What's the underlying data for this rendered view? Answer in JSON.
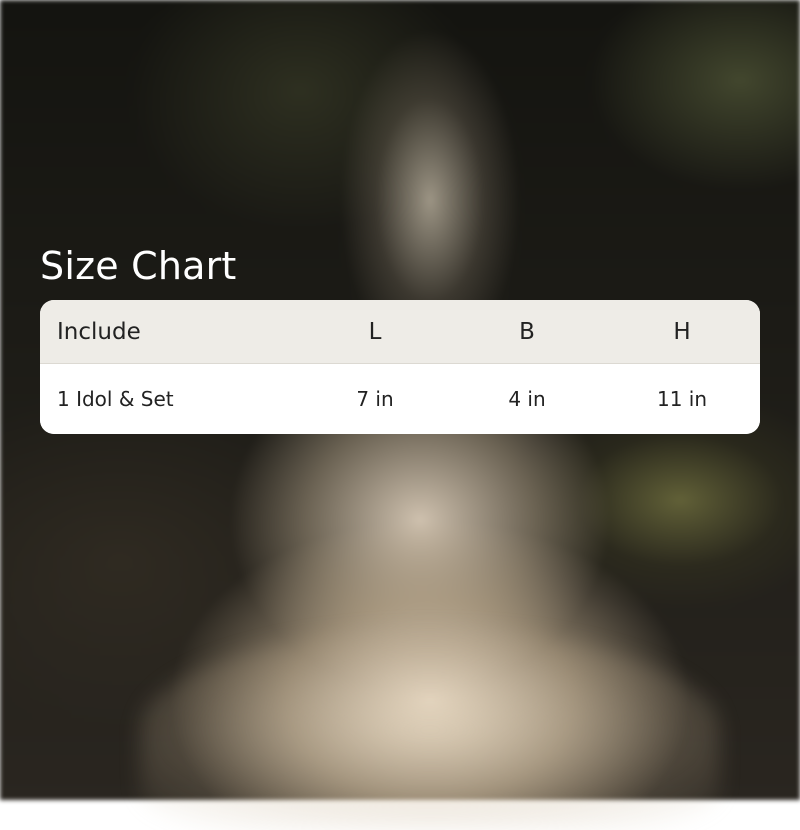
{
  "title": "Size Chart",
  "table": {
    "headers": [
      "Include",
      "L",
      "B",
      "H"
    ],
    "rows": [
      [
        "1 Idol & Set",
        "7 in",
        "4 in",
        "11 in"
      ]
    ]
  }
}
